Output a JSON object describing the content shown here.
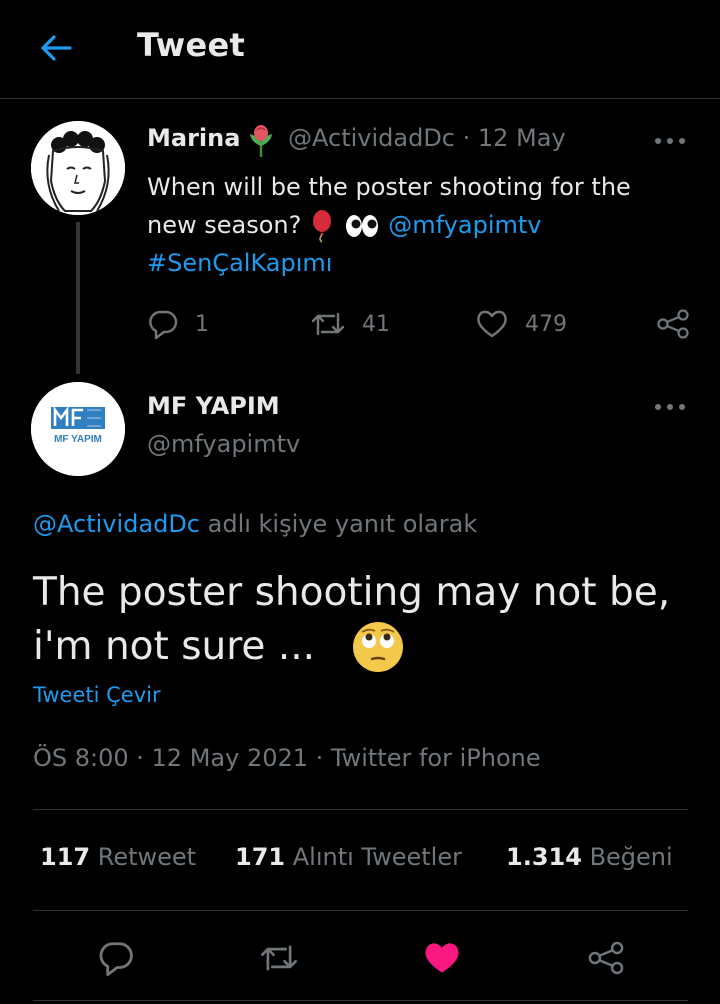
{
  "header": {
    "title": "Tweet",
    "back_icon": "arrow-left-icon",
    "accent": "#1d9bf0"
  },
  "parent_tweet": {
    "display_name": "Marina",
    "handle": "@ActividadDc",
    "date": "12 May",
    "meta": "@ActividadDc · 12 May",
    "text_part1": "When will be the poster shooting for the new season?",
    "mention": "@mfyapimtv",
    "hashtag": "#SenÇalKapımı",
    "replies": "1",
    "retweets": "41",
    "likes": "479"
  },
  "main_tweet": {
    "display_name": "MF YAPIM",
    "handle": "@mfyapimtv",
    "avatar_logo_text": "MF YAPIM",
    "reply_to_handle": "@ActividadDc",
    "reply_to_suffix": " adlı kişiye yanıt olarak",
    "text_line1": "The poster shooting may not be,",
    "text_line2": "i'm not sure ...",
    "translate_label": "Tweeti Çevir",
    "timestamp": "ÖS 8:00 · 12 May 2021 · Twitter for iPhone",
    "stats": {
      "retweets_count": "117",
      "retweets_label": "Retweet",
      "quotes_count": "171",
      "quotes_label": "Alıntı Tweetler",
      "likes_count": "1.314",
      "likes_label": "Beğeni"
    },
    "liked": true,
    "like_color": "#f91880"
  }
}
